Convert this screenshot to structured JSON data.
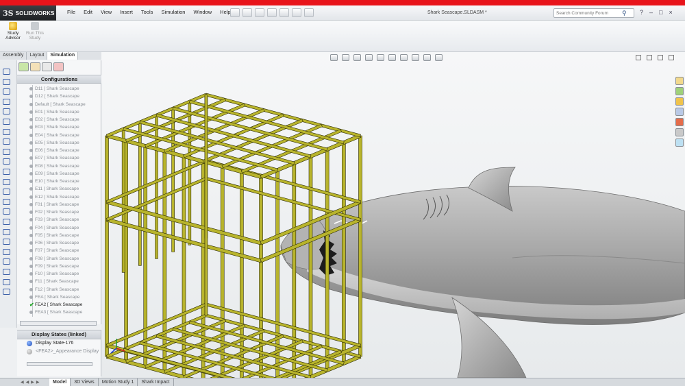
{
  "app": {
    "brand": "SOLIDWORKS",
    "document_title": "Shark Seascape.SLDASM *"
  },
  "menu": [
    "File",
    "Edit",
    "View",
    "Insert",
    "Tools",
    "Simulation",
    "Window",
    "Help"
  ],
  "search": {
    "placeholder": "Search Community Forum"
  },
  "command_manager": {
    "study_advisor": "Study Advisor",
    "run_study": "Run This Study"
  },
  "tabs": [
    {
      "label": "Assembly",
      "active": false
    },
    {
      "label": "Layout",
      "active": false
    },
    {
      "label": "Simulation",
      "active": true
    }
  ],
  "configurations": {
    "header": "Configurations",
    "items": [
      {
        "name": "D11 [ Shark Seascape",
        "active": false
      },
      {
        "name": "D12 [ Shark Seascape",
        "active": false
      },
      {
        "name": "Default [ Shark Seascape",
        "active": false
      },
      {
        "name": "E01 [ Shark Seascape",
        "active": false
      },
      {
        "name": "E02 [ Shark Seascape",
        "active": false
      },
      {
        "name": "E03 [ Shark Seascape",
        "active": false
      },
      {
        "name": "E04 [ Shark Seascape",
        "active": false
      },
      {
        "name": "E05 [ Shark Seascape",
        "active": false
      },
      {
        "name": "E06 [ Shark Seascape",
        "active": false
      },
      {
        "name": "E07 [ Shark Seascape",
        "active": false
      },
      {
        "name": "E08 [ Shark Seascape",
        "active": false
      },
      {
        "name": "E09 [ Shark Seascape",
        "active": false
      },
      {
        "name": "E10 [ Shark Seascape",
        "active": false
      },
      {
        "name": "E11 [ Shark Seascape",
        "active": false
      },
      {
        "name": "E12 [ Shark Seascape",
        "active": false
      },
      {
        "name": "F01 [ Shark Seascape",
        "active": false
      },
      {
        "name": "F02 [ Shark Seascape",
        "active": false
      },
      {
        "name": "F03 [ Shark Seascape",
        "active": false
      },
      {
        "name": "F04 [ Shark Seascape",
        "active": false
      },
      {
        "name": "F05 [ Shark Seascape",
        "active": false
      },
      {
        "name": "F06 [ Shark Seascape",
        "active": false
      },
      {
        "name": "F07 [ Shark Seascape",
        "active": false
      },
      {
        "name": "F08 [ Shark Seascape",
        "active": false
      },
      {
        "name": "F09 [ Shark Seascape",
        "active": false
      },
      {
        "name": "F10 [ Shark Seascape",
        "active": false
      },
      {
        "name": "F11 [ Shark Seascape",
        "active": false
      },
      {
        "name": "F12 [ Shark Seascape",
        "active": false
      },
      {
        "name": "FEA [ Shark Seascape",
        "active": false
      },
      {
        "name": "FEA2 [ Shark Seascape",
        "active": true
      },
      {
        "name": "FEA3 [ Shark Seascape",
        "active": false
      }
    ]
  },
  "display_states": {
    "header": "Display States (linked)",
    "items": [
      {
        "name": "Display State-176",
        "dim": false
      },
      {
        "name": "<FEA2>_Appearance Display",
        "dim": true
      }
    ]
  },
  "bottom_tabs": [
    {
      "label": "Model",
      "active": true
    },
    {
      "label": "3D Views",
      "active": false
    },
    {
      "label": "Motion Study 1",
      "active": false
    },
    {
      "label": "Shark Impact",
      "active": false
    }
  ],
  "colors": {
    "brand_red": "#e8141b",
    "cage": "#b8b42c",
    "shark": "#a9a9a9",
    "viewport_bg": "#eef0f1"
  }
}
